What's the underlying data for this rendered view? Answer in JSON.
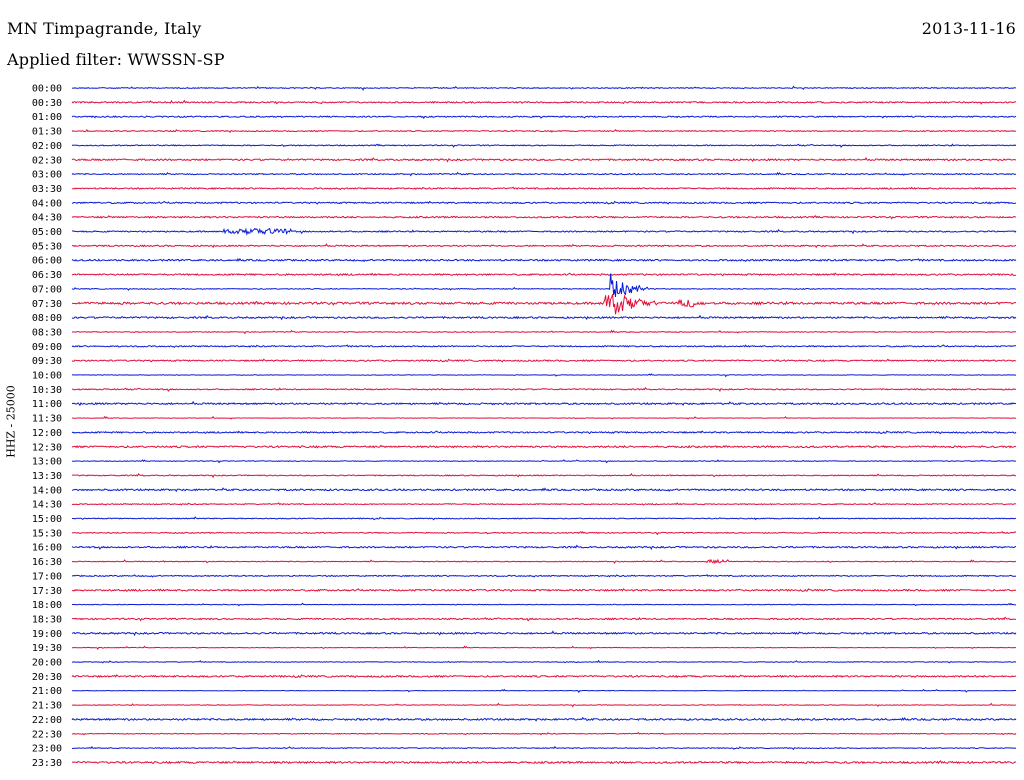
{
  "header": {
    "station": "MN Timpagrande, Italy",
    "date": "2013-11-16",
    "filter": "Applied filter: WWSSN-SP"
  },
  "channel_label": "HHZ - 25000",
  "colors": {
    "series_a": "#0a1bd6",
    "series_b": "#e0103c",
    "text": "#000000"
  },
  "chart_data": {
    "type": "line",
    "title": "MN Timpagrande, Italy",
    "subtitle": "Applied filter: WWSSN-SP",
    "ylabel": "HHZ - 25000",
    "row_labels": [
      "00:00",
      "00:30",
      "01:00",
      "01:30",
      "02:00",
      "02:30",
      "03:00",
      "03:30",
      "04:00",
      "04:30",
      "05:00",
      "05:30",
      "06:00",
      "06:30",
      "07:00",
      "07:30",
      "08:00",
      "08:30",
      "09:00",
      "09:30",
      "10:00",
      "10:30",
      "11:00",
      "11:30",
      "12:00",
      "12:30",
      "13:00",
      "13:30",
      "14:00",
      "14:30",
      "15:00",
      "15:30",
      "16:00",
      "16:30",
      "17:00",
      "17:30",
      "18:00",
      "18:30",
      "19:00",
      "19:30",
      "20:00",
      "20:30",
      "21:00",
      "21:30",
      "22:00",
      "22:30",
      "23:00",
      "23:30"
    ],
    "row_minutes": 30,
    "alternating_colors": [
      "#0a1bd6",
      "#e0103c"
    ],
    "notable_events": [
      {
        "row": "07:00",
        "minute": 17.1,
        "description": "earthquake P onset"
      },
      {
        "row": "07:30",
        "minute": 17.1,
        "description": "strong shaking"
      },
      {
        "row": "07:30",
        "minute": 19.6,
        "description": "secondary arrival"
      },
      {
        "row": "05:00",
        "minute": 5.9,
        "description": "noise burst"
      },
      {
        "row": "16:30",
        "minute": 20.5,
        "description": "small event"
      }
    ]
  }
}
